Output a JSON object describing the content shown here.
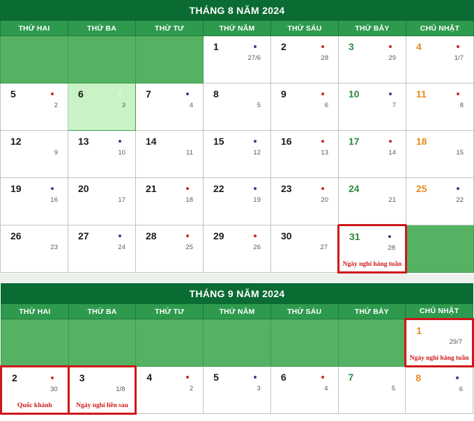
{
  "colors": {
    "title_bg": "#0a6b33",
    "dow_bg": "#2e9a4e",
    "empty_cell": "#55b263",
    "today_cell": "#c9f3c6",
    "holiday_border": "#cf1717",
    "saturday_text": "#2d8a3e",
    "sunday_text": "#e8891c",
    "dot_red": "#c42b2b",
    "dot_purple": "#5b2d83"
  },
  "weekday_headers": [
    "THỨ HAI",
    "THỨ BA",
    "THỨ TƯ",
    "THỨ NĂM",
    "THỨ SÁU",
    "THỨ BẢY",
    "CHỦ NHẬT"
  ],
  "months": [
    {
      "title": "THÁNG 8 NĂM 2024",
      "weeks": [
        [
          {
            "empty": true
          },
          {
            "empty": true
          },
          {
            "empty": true
          },
          {
            "solar": "1",
            "lunar": "27/6",
            "dot": "purple"
          },
          {
            "solar": "2",
            "lunar": "28",
            "dot": "red"
          },
          {
            "solar": "3",
            "lunar": "29",
            "dot": "red",
            "kind": "sat"
          },
          {
            "solar": "4",
            "lunar": "1/7",
            "dot": "red",
            "kind": "sun"
          }
        ],
        [
          {
            "solar": "5",
            "lunar": "2",
            "dot": "red"
          },
          {
            "solar": "6",
            "lunar": "3",
            "dot": "faint",
            "today": true
          },
          {
            "solar": "7",
            "lunar": "4",
            "dot": "purple"
          },
          {
            "solar": "8",
            "lunar": "5",
            "dot": ""
          },
          {
            "solar": "9",
            "lunar": "6",
            "dot": "red"
          },
          {
            "solar": "10",
            "lunar": "7",
            "dot": "purple",
            "kind": "sat"
          },
          {
            "solar": "11",
            "lunar": "8",
            "dot": "red",
            "kind": "sun"
          }
        ],
        [
          {
            "solar": "12",
            "lunar": "9",
            "dot": ""
          },
          {
            "solar": "13",
            "lunar": "10",
            "dot": "purple"
          },
          {
            "solar": "14",
            "lunar": "11",
            "dot": ""
          },
          {
            "solar": "15",
            "lunar": "12",
            "dot": "purple"
          },
          {
            "solar": "16",
            "lunar": "13",
            "dot": "red"
          },
          {
            "solar": "17",
            "lunar": "14",
            "dot": "red",
            "kind": "sat"
          },
          {
            "solar": "18",
            "lunar": "15",
            "dot": "",
            "kind": "sun"
          }
        ],
        [
          {
            "solar": "19",
            "lunar": "16",
            "dot": "purple"
          },
          {
            "solar": "20",
            "lunar": "17",
            "dot": ""
          },
          {
            "solar": "21",
            "lunar": "18",
            "dot": "red"
          },
          {
            "solar": "22",
            "lunar": "19",
            "dot": "purple"
          },
          {
            "solar": "23",
            "lunar": "20",
            "dot": "red"
          },
          {
            "solar": "24",
            "lunar": "21",
            "dot": "",
            "kind": "sat"
          },
          {
            "solar": "25",
            "lunar": "22",
            "dot": "purple",
            "kind": "sun"
          }
        ],
        [
          {
            "solar": "26",
            "lunar": "23",
            "dot": ""
          },
          {
            "solar": "27",
            "lunar": "24",
            "dot": "purple"
          },
          {
            "solar": "28",
            "lunar": "25",
            "dot": "red"
          },
          {
            "solar": "29",
            "lunar": "26",
            "dot": "red"
          },
          {
            "solar": "30",
            "lunar": "27",
            "dot": ""
          },
          {
            "solar": "31",
            "lunar": "28",
            "dot": "purple",
            "kind": "sat",
            "note": "Ngày nghỉ hàng tuần",
            "holiday": true
          },
          {
            "empty": true
          }
        ]
      ]
    },
    {
      "title": "THÁNG 9 NĂM 2024",
      "weeks": [
        [
          {
            "empty": true
          },
          {
            "empty": true
          },
          {
            "empty": true
          },
          {
            "empty": true
          },
          {
            "empty": true
          },
          {
            "empty": true
          },
          {
            "solar": "1",
            "lunar": "29/7",
            "dot": "",
            "kind": "sun",
            "note": "Ngày nghỉ hàng tuần",
            "holiday": true
          }
        ],
        [
          {
            "solar": "2",
            "lunar": "30",
            "dot": "red",
            "note": "Quốc khánh",
            "holiday": true
          },
          {
            "solar": "3",
            "lunar": "1/8",
            "dot": "",
            "note": "Ngày nghỉ liền sau",
            "holiday": true
          },
          {
            "solar": "4",
            "lunar": "2",
            "dot": "red"
          },
          {
            "solar": "5",
            "lunar": "3",
            "dot": "purple"
          },
          {
            "solar": "6",
            "lunar": "4",
            "dot": "red"
          },
          {
            "solar": "7",
            "lunar": "5",
            "dot": "",
            "kind": "sat"
          },
          {
            "solar": "8",
            "lunar": "6",
            "dot": "purple",
            "kind": "sun"
          }
        ]
      ]
    }
  ]
}
